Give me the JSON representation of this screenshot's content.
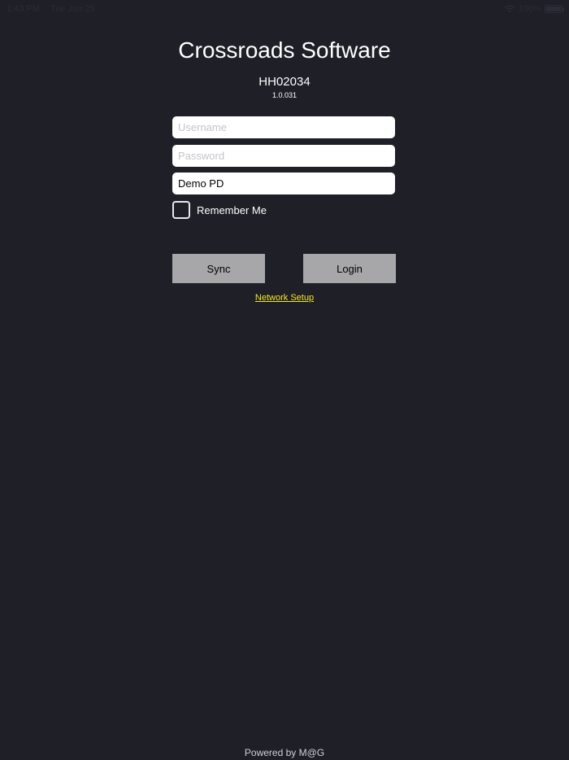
{
  "status_bar": {
    "time": "1:43 PM",
    "date": "Tue Jun 25",
    "battery": "100%",
    "wifi_icon": "wifi-icon",
    "battery_icon": "battery-icon"
  },
  "app": {
    "title": "Crossroads Software",
    "device_id": "HH02034",
    "version": "1.0.031"
  },
  "form": {
    "username_placeholder": "Username",
    "username_value": "",
    "password_placeholder": "Password",
    "password_value": "",
    "department_value": "Demo PD",
    "remember_label": "Remember Me",
    "remember_checked": false
  },
  "buttons": {
    "sync_label": "Sync",
    "login_label": "Login"
  },
  "links": {
    "network_setup": "Network Setup"
  },
  "footer": {
    "powered_by": "Powered by M@G"
  },
  "colors": {
    "background": "#1e1f27",
    "button": "#a7a7a9",
    "link": "#f4e721"
  }
}
